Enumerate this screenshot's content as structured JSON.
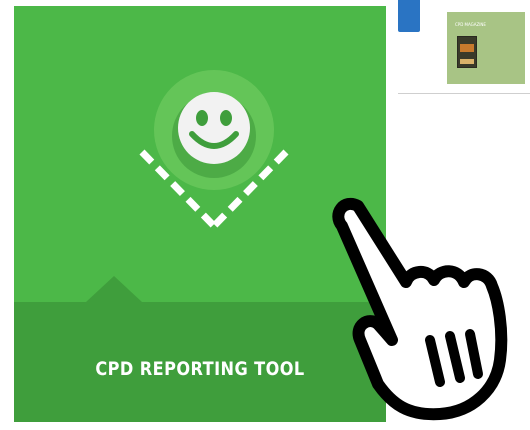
{
  "tool_card": {
    "label": "CPD REPORTING TOOL",
    "colors": {
      "tile": "#4cb848",
      "footer": "#3f9e3c"
    }
  },
  "illustration": {
    "icon": "smiley-face-icon"
  },
  "top_right": {
    "blue_button_label": "",
    "magazine_title": "CPD MAGAZINE",
    "colors": {
      "button": "#2a74c3",
      "thumbnail": "#a8c485"
    }
  },
  "overlay": {
    "icon": "pointing-hand-icon"
  }
}
